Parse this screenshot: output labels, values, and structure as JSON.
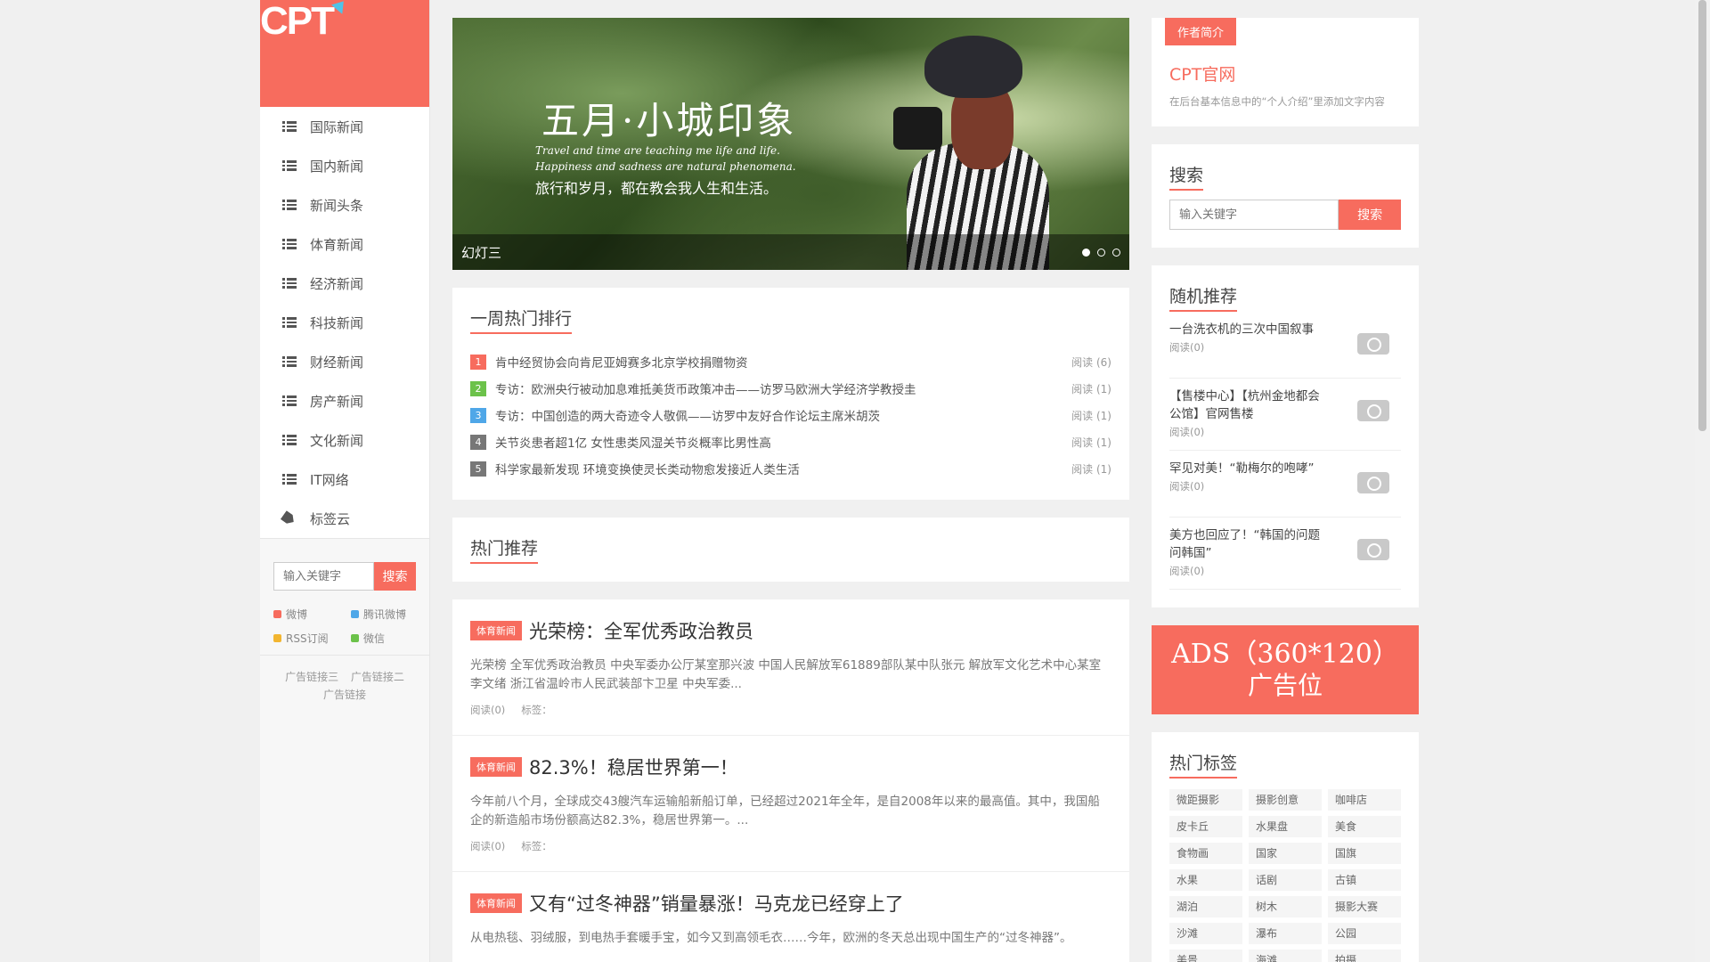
{
  "logo": {
    "text": "CPT"
  },
  "nav": [
    {
      "label": "国际新闻",
      "icon": "list-icon"
    },
    {
      "label": "国内新闻",
      "icon": "list-icon"
    },
    {
      "label": "新闻头条",
      "icon": "list-icon"
    },
    {
      "label": "体育新闻",
      "icon": "list-icon"
    },
    {
      "label": "经济新闻",
      "icon": "list-icon"
    },
    {
      "label": "科技新闻",
      "icon": "list-icon"
    },
    {
      "label": "财经新闻",
      "icon": "list-icon"
    },
    {
      "label": "房产新闻",
      "icon": "list-icon"
    },
    {
      "label": "文化新闻",
      "icon": "list-icon"
    },
    {
      "label": "IT网络",
      "icon": "list-icon"
    },
    {
      "label": "标签云",
      "icon": "tag-icon"
    }
  ],
  "side_search": {
    "placeholder": "输入关键字",
    "button": "搜索"
  },
  "social": [
    {
      "label": "微博",
      "color": "#f76c5e"
    },
    {
      "label": "腾讯微博",
      "color": "#4fa7e8"
    },
    {
      "label": "RSS订阅",
      "color": "#f2b530"
    },
    {
      "label": "微信",
      "color": "#6cc24a"
    }
  ],
  "ad_links": [
    "广告链接三",
    "广告链接二",
    "广告链接"
  ],
  "slider": {
    "title": "五月·小城印象",
    "sub1": "Travel and time are teaching me life and life.",
    "sub2": "Happiness and sadness are natural phenomena.",
    "cn": "旅行和岁月，都在教会我人生和生活。",
    "caption": "幻灯三",
    "pages": 3,
    "active_page": 1
  },
  "hot_week": {
    "title": "一周热门排行",
    "items": [
      {
        "num": "1",
        "color": "#f76c5e",
        "text": "肯中经贸协会向肯尼亚姆赛多北京学校捐赠物资",
        "read": "阅读 (6)"
      },
      {
        "num": "2",
        "color": "#6cc24a",
        "text": "专访：欧洲央行被动加息难抵美货币政策冲击——访罗马欧洲大学经济学教授圭",
        "read": "阅读 (1)"
      },
      {
        "num": "3",
        "color": "#4fa7e8",
        "text": "专访：中国创造的两大奇迹令人敬佩——访罗中友好合作论坛主席米胡茨",
        "read": "阅读 (1)"
      },
      {
        "num": "4",
        "color": "#777777",
        "text": "关节炎患者超1亿 女性患类风湿关节炎概率比男性高",
        "read": "阅读 (1)"
      },
      {
        "num": "5",
        "color": "#777777",
        "text": "科学家最新发现 环境变换使灵长类动物愈发接近人类生活",
        "read": "阅读 (1)"
      }
    ]
  },
  "hot_recommend": {
    "title": "热门推荐"
  },
  "articles": [
    {
      "category": "体育新闻",
      "title": "光荣榜：全军优秀政治教员",
      "body": "光荣榜 全军优秀政治教员 中央军委办公厅某室那兴波 中国人民解放军61889部队某中队张元 解放军文化艺术中心某室李文绪 浙江省温岭市人民武装部卞卫星 中央军委...",
      "read": "阅读(0)",
      "tags": "标签："
    },
    {
      "category": "体育新闻",
      "title": "82.3%！稳居世界第一！",
      "body": "今年前八个月，全球成交43艘汽车运输船新船订单，已经超过2021年全年，是自2008年以来的最高值。其中，我国船企的新造船市场份额高达82.3%，稳居世界第一。...",
      "read": "阅读(0)",
      "tags": "标签："
    },
    {
      "category": "体育新闻",
      "title": "又有“过冬神器”销量暴涨！马克龙已经穿上了",
      "body": "从电热毯、羽绒服，到电热手套暖手宝，如今又到高领毛衣……今年，欧洲的冬天总出现中国生产的“过冬神器”。",
      "read": "",
      "tags": ""
    }
  ],
  "about": {
    "tag": "作者简介",
    "name": "CPT官网",
    "desc": "在后台基本信息中的“个人介绍”里添加文字内容"
  },
  "right_search": {
    "title": "搜索",
    "placeholder": "输入关键字",
    "button": "搜索"
  },
  "random": {
    "title": "随机推荐",
    "items": [
      {
        "title": "一台洗衣机的三次中国叙事",
        "read": "阅读(0)"
      },
      {
        "title": "【售楼中心】【杭州金地都会公馆】官网售楼",
        "read": "阅读(0)"
      },
      {
        "title": "罕见对美！“勒梅尔的咆哮”",
        "read": "阅读(0)"
      },
      {
        "title": "美方也回应了！“韩国的问题问韩国”",
        "read": "阅读(0)"
      }
    ]
  },
  "ads": {
    "line1": "ADS（360*120）",
    "line2": "广告位"
  },
  "hot_tags": {
    "title": "热门标签",
    "items": [
      "微距摄影",
      "摄影创意",
      "咖啡店",
      "皮卡丘",
      "水果盘",
      "美食",
      "食物画",
      "国家",
      "国旗",
      "水果",
      "话剧",
      "古镇",
      "湖泊",
      "树木",
      "摄影大赛",
      "沙滩",
      "瀑布",
      "公园",
      "美景",
      "海滩",
      "拍摄"
    ]
  }
}
